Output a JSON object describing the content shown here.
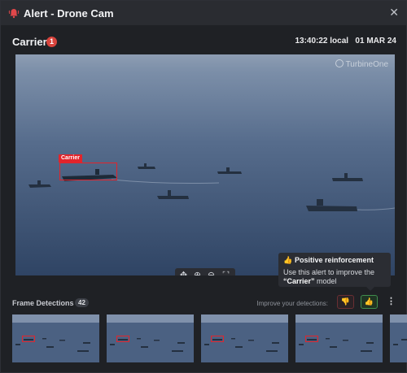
{
  "window": {
    "title": "Alert - Drone Cam",
    "close_icon": "close-icon",
    "bell_icon": "bell-icon",
    "accent_color": "#e2242b"
  },
  "header": {
    "label": "Carrier",
    "badge_count": "1",
    "time": "13:40:22 local",
    "date": "01 MAR 24"
  },
  "media": {
    "watermark": "TurbineOne",
    "detection_label": "Carrier",
    "zoom_controls": [
      "move-icon",
      "zoom-in-icon",
      "zoom-out-icon",
      "fullscreen-icon"
    ]
  },
  "tooltip": {
    "title": "Positive reinforcement",
    "body_prefix": "Use this alert to improve the ",
    "model_name": "“Carrier”",
    "body_suffix": " model"
  },
  "detections": {
    "label": "Frame Detections",
    "count": "42",
    "improve_text": "Improve your detections:",
    "thumbs_down_icon": "thumbs-down-icon",
    "thumbs_up_icon": "thumbs-up-icon",
    "more_icon": "more-vertical-icon"
  },
  "colors": {
    "positive": "#55c06a",
    "negative": "#e0474a",
    "badge": "#d8443d"
  }
}
